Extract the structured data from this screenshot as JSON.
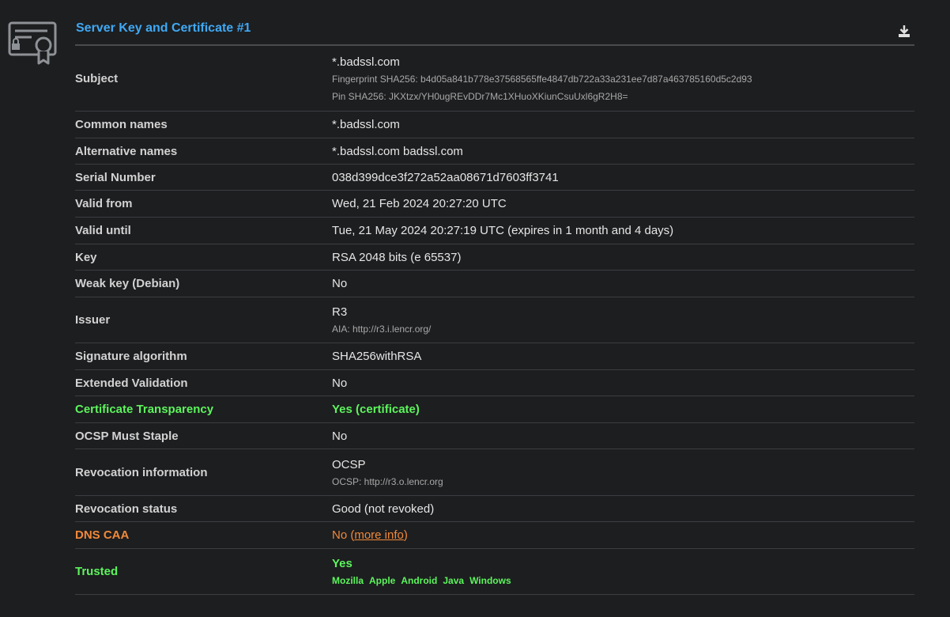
{
  "header": {
    "title": "Server Key and Certificate #1",
    "icon": "certificate-icon",
    "download_icon": "download-icon"
  },
  "rows": {
    "subject": {
      "label": "Subject",
      "value": "*.badssl.com",
      "fingerprint": "Fingerprint SHA256: b4d05a841b778e37568565ffe4847db722a33a231ee7d87a463785160d5c2d93",
      "pin": "Pin SHA256: JKXtzx/YH0ugREvDDr7Mc1XHuoXKiunCsuUxl6gR2H8="
    },
    "common_names": {
      "label": "Common names",
      "value": "*.badssl.com"
    },
    "alt_names": {
      "label": "Alternative names",
      "value": "*.badssl.com badssl.com"
    },
    "serial": {
      "label": "Serial Number",
      "value": "038d399dce3f272a52aa08671d7603ff3741"
    },
    "valid_from": {
      "label": "Valid from",
      "value": "Wed, 21 Feb 2024 20:27:20 UTC"
    },
    "valid_until": {
      "label": "Valid until",
      "value": "Tue, 21 May 2024 20:27:19 UTC (expires in 1 month and 4 days)"
    },
    "key": {
      "label": "Key",
      "value": "RSA 2048 bits (e 65537)"
    },
    "weak_key": {
      "label": "Weak key (Debian)",
      "value": "No"
    },
    "issuer": {
      "label": "Issuer",
      "value": "R3",
      "aia": "AIA: http://r3.i.lencr.org/"
    },
    "sig_alg": {
      "label": "Signature algorithm",
      "value": "SHA256withRSA"
    },
    "ev": {
      "label": "Extended Validation",
      "value": "No"
    },
    "ct": {
      "label": "Certificate Transparency",
      "value": "Yes (certificate)"
    },
    "ocsp_staple": {
      "label": "OCSP Must Staple",
      "value": "No"
    },
    "revocation_info": {
      "label": "Revocation information",
      "value": "OCSP",
      "ocsp": "OCSP: http://r3.o.lencr.org"
    },
    "revocation_status": {
      "label": "Revocation status",
      "value": "Good (not revoked)"
    },
    "dns_caa": {
      "label": "DNS CAA",
      "value": "No (",
      "link": "more info",
      "suffix": ")"
    },
    "trusted": {
      "label": "Trusted",
      "value": "Yes",
      "stores": [
        "Mozilla",
        "Apple",
        "Android",
        "Java",
        "Windows"
      ]
    }
  },
  "colors": {
    "background": "#1d1e20",
    "title": "#3fa9f5",
    "good": "#5cf55c",
    "warning": "#f0893a"
  }
}
